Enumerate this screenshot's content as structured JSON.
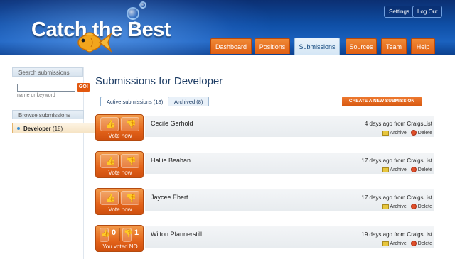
{
  "app": {
    "logo_text": "Catch the Best",
    "top_buttons": {
      "settings": "Settings",
      "logout": "Log Out"
    },
    "nav_tabs": [
      {
        "label": "Dashboard",
        "active": false
      },
      {
        "label": "Positions",
        "active": false
      },
      {
        "label": "Submissions",
        "active": true
      },
      {
        "label": "Sources",
        "active": false
      },
      {
        "label": "Team",
        "active": false
      },
      {
        "label": "Help",
        "active": false
      }
    ]
  },
  "sidebar": {
    "search_heading": "Search submissions",
    "search_value": "",
    "go_label": "GO!",
    "search_hint": "name or keyword",
    "browse_heading": "Browse submissions",
    "selected_item": {
      "label": "Developer",
      "count": "(18)"
    }
  },
  "main": {
    "title": "Submissions for Developer",
    "subtabs": [
      {
        "label": "Active submissions (18)",
        "active": true
      },
      {
        "label": "Archived (8)",
        "active": false
      }
    ],
    "create_button": "CREATE A NEW SUBMISSION",
    "submissions": [
      {
        "name": "Cecile Gerhold",
        "source": "4 days ago from CraigsList",
        "vote_label": "Vote now",
        "voted": false
      },
      {
        "name": "Hallie Beahan",
        "source": "17 days ago from CraigsList",
        "vote_label": "Vote now",
        "voted": false
      },
      {
        "name": "Jaycee Ebert",
        "source": "17 days ago from CraigsList",
        "vote_label": "Vote now",
        "voted": false
      },
      {
        "name": "Wilton Pfannerstill",
        "source": "19 days ago from CraigsList",
        "vote_label": "You voted NO",
        "voted": true,
        "up_count": "0",
        "down_count": "1"
      }
    ],
    "archive_label": "Archive",
    "delete_label": "Delete"
  },
  "colors": {
    "header": "#0f4fa6",
    "accent": "#e05e12",
    "title": "#1d3c64"
  }
}
